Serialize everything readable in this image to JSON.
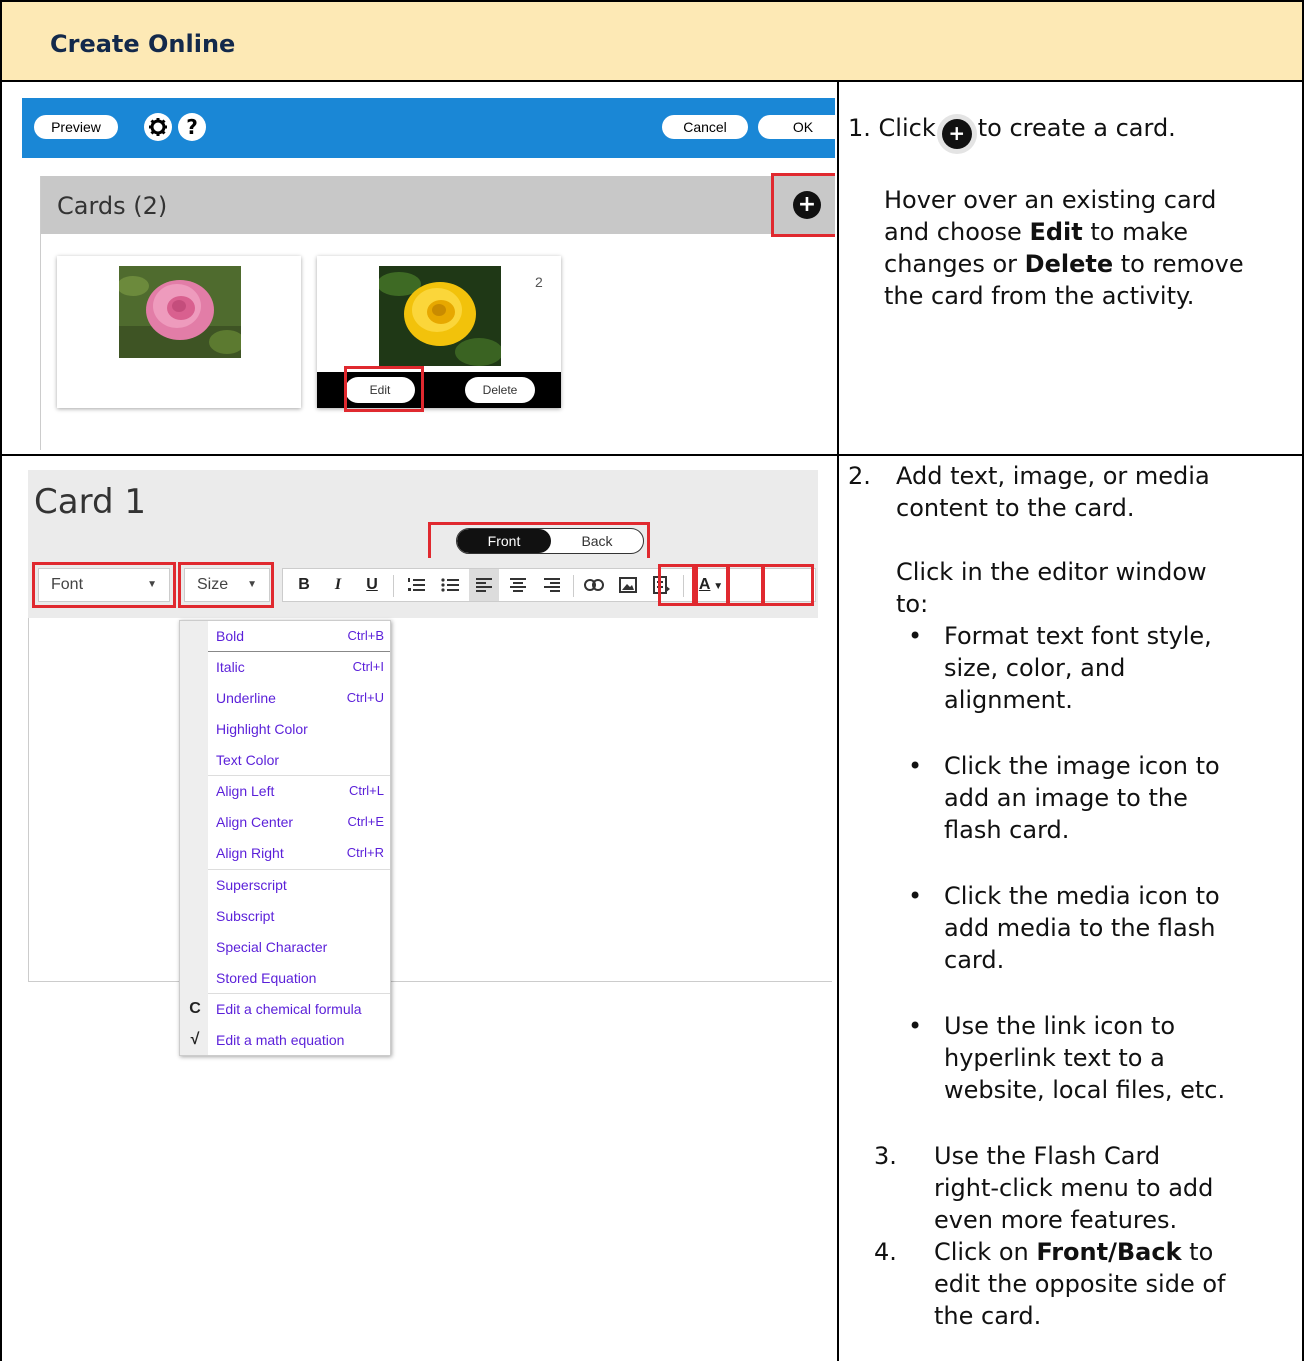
{
  "header": {
    "title": "Create Online"
  },
  "shot1": {
    "topbar": {
      "preview_label": "Preview",
      "settings_icon": "gear-icon",
      "help_icon": "question-icon",
      "help_glyph": "?",
      "cancel_label": "Cancel",
      "ok_label": "OK"
    },
    "cards_heading": "Cards (2)",
    "add_icon": "plus-icon",
    "add_glyph": "+",
    "card2_number": "2",
    "edit_label": "Edit",
    "delete_label": "Delete"
  },
  "instructions": {
    "step1_prefix": "1. Click",
    "step1_suffix": "to create a card.",
    "step1_plus": "+",
    "step1_hover_a": "Hover over an existing card",
    "step1_hover_b_pre": "and choose ",
    "step1_hover_b_bold": "Edit",
    "step1_hover_b_post": " to make",
    "step1_hover_c_pre": "changes or ",
    "step1_hover_c_bold": "Delete",
    "step1_hover_c_post": " to remove",
    "step1_hover_d": "the card from the activity.",
    "step2_num": "2.",
    "step2_a": "Add text, image, or media",
    "step2_b": "content to the card.",
    "step2_c": "Click in the editor window",
    "step2_d": "to:",
    "bullets": [
      [
        "Format text font style,",
        "size, color, and",
        "alignment."
      ],
      [
        "Click the image icon to",
        "add an image to the",
        "flash card."
      ],
      [
        "Click the media icon to",
        "add media to the flash",
        "card."
      ],
      [
        "Use the link icon to",
        "hyperlink text to a",
        "website, local files, etc."
      ]
    ],
    "step3_num": "3.",
    "step3_a": "Use the Flash Card",
    "step3_b": "right-click menu to add",
    "step3_c": "even more features.",
    "step4_num": "4.",
    "step4_a_pre": "Click on ",
    "step4_a_bold": "Front/Back",
    "step4_a_post": " to",
    "step4_b": "edit the opposite side of",
    "step4_c": "the card."
  },
  "shot2": {
    "card_title": "Card 1",
    "toggle_front": "Front",
    "toggle_back": "Back",
    "font_label": "Font",
    "size_label": "Size",
    "tools": {
      "bold": "B",
      "italic": "I",
      "underline": "U"
    },
    "context_menu": [
      {
        "label": "Bold",
        "shortcut": "Ctrl+B"
      },
      {
        "label": "Italic",
        "shortcut": "Ctrl+I"
      },
      {
        "label": "Underline",
        "shortcut": "Ctrl+U"
      },
      {
        "label": "Highlight Color",
        "shortcut": ""
      },
      {
        "label": "Text Color",
        "shortcut": ""
      },
      {
        "label": "Align Left",
        "shortcut": "Ctrl+L"
      },
      {
        "label": "Align Center",
        "shortcut": "Ctrl+E"
      },
      {
        "label": "Align Right",
        "shortcut": "Ctrl+R"
      },
      {
        "label": "Superscript",
        "shortcut": ""
      },
      {
        "label": "Subscript",
        "shortcut": ""
      },
      {
        "label": "Special Character",
        "shortcut": ""
      },
      {
        "label": "Stored Equation",
        "shortcut": ""
      },
      {
        "label": "Edit a chemical formula",
        "shortcut": "",
        "icon": "C"
      },
      {
        "label": "Edit a math equation",
        "shortcut": "",
        "icon": "√"
      }
    ]
  },
  "colors": {
    "header_bg": "#fde9b5",
    "header_text": "#13294b",
    "topbar_blue": "#1a87d6",
    "highlight_red": "#e0292f",
    "menu_text": "#5a1fd9"
  }
}
